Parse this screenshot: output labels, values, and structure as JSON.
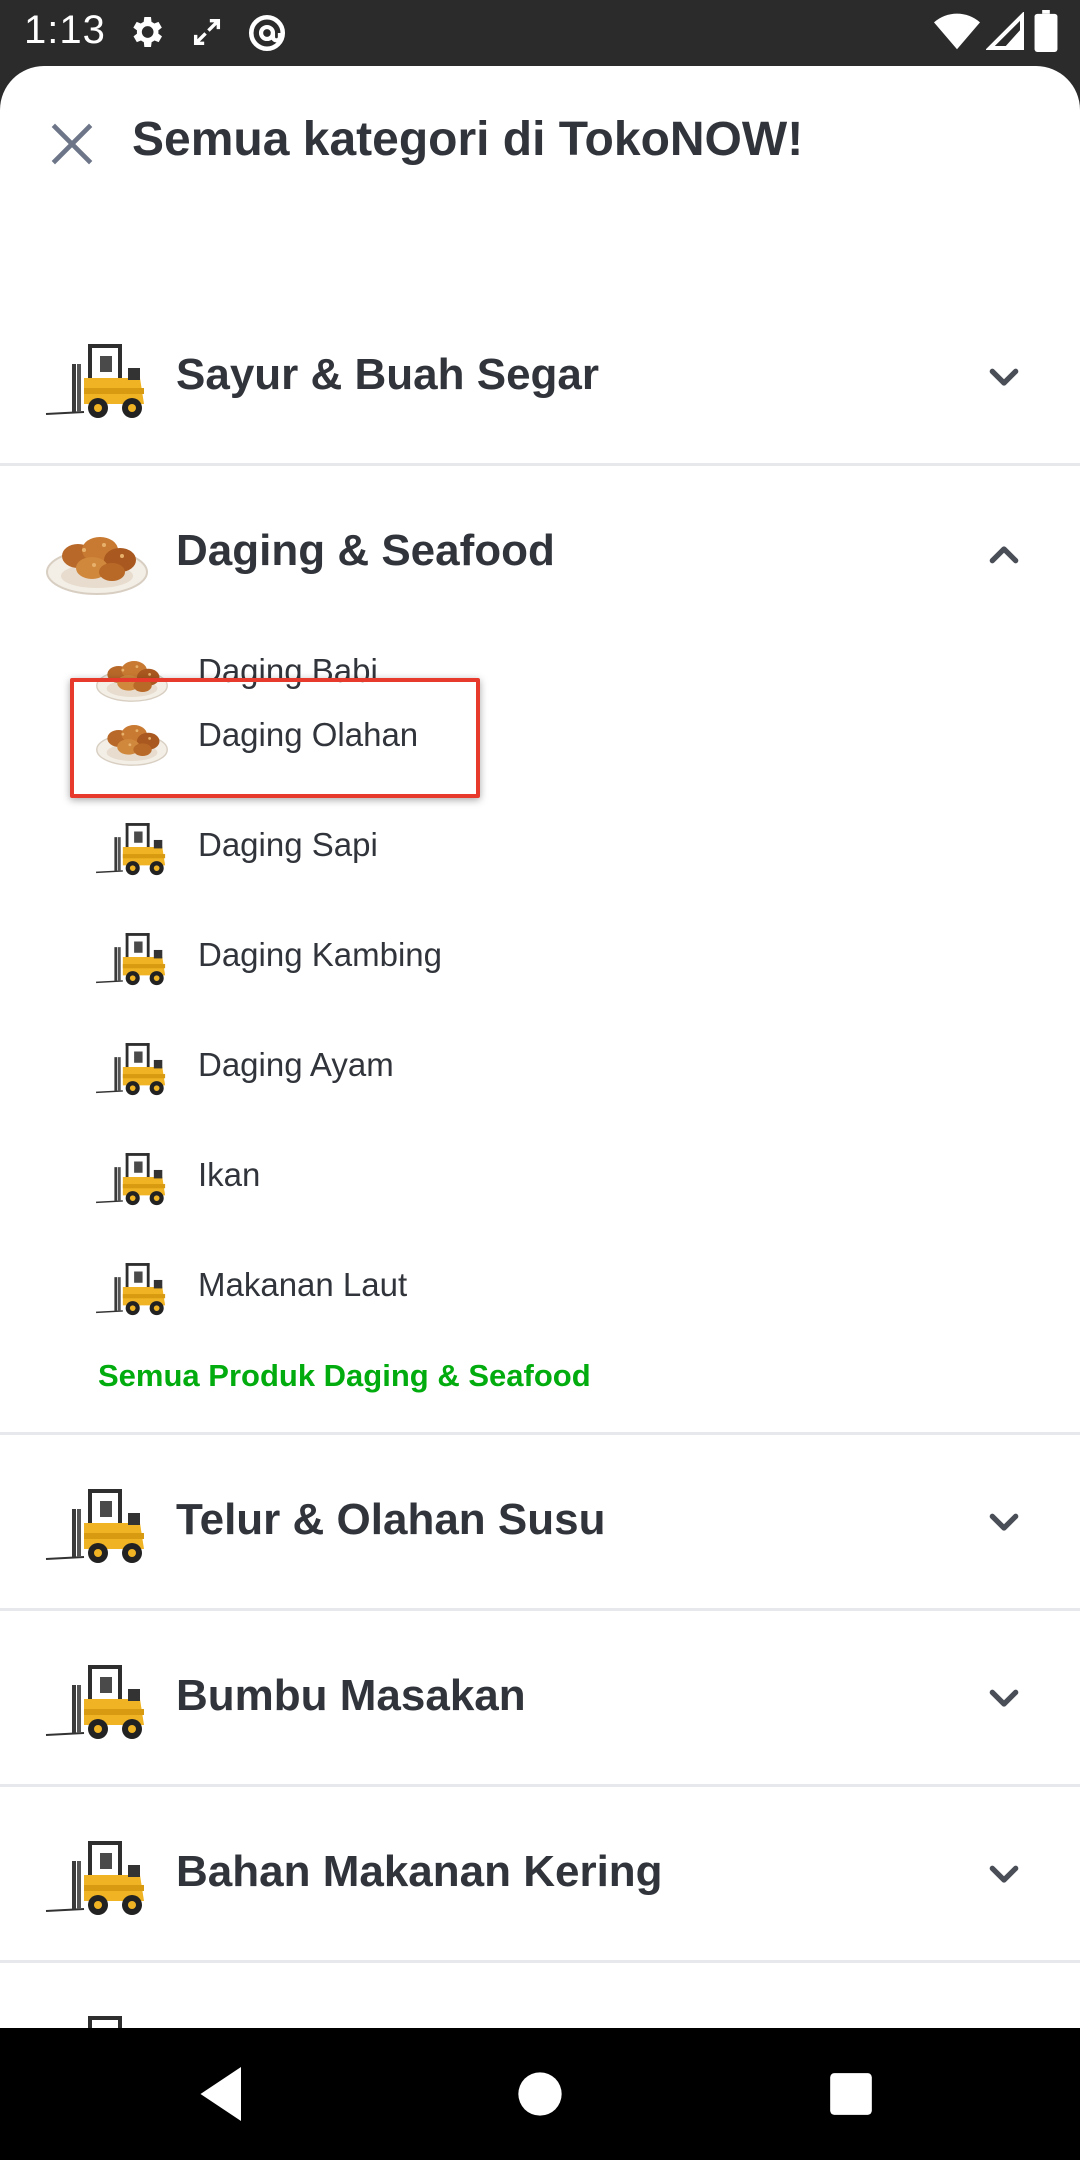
{
  "status_bar": {
    "time": "1:13",
    "icons": [
      "gear-icon",
      "expand-icon",
      "at-sign-icon",
      "wifi-icon",
      "signal-icon",
      "battery-icon"
    ]
  },
  "sheet": {
    "title": "Semua kategori di TokoNOW!",
    "close_icon": "close-icon"
  },
  "categories": [
    {
      "label": "Sayur & Buah Segar",
      "thumb": "forklift",
      "expanded": false
    },
    {
      "label": "Daging & Seafood",
      "thumb": "food",
      "expanded": true,
      "sub_items": [
        {
          "label": "Daging Babi",
          "thumb": "food"
        },
        {
          "label": "Daging Olahan",
          "thumb": "food",
          "highlighted": true
        },
        {
          "label": "Daging Sapi",
          "thumb": "forklift"
        },
        {
          "label": "Daging Kambing",
          "thumb": "forklift"
        },
        {
          "label": "Daging Ayam",
          "thumb": "forklift"
        },
        {
          "label": "Ikan",
          "thumb": "forklift"
        },
        {
          "label": "Makanan Laut",
          "thumb": "forklift"
        }
      ],
      "see_all": "Semua Produk Daging & Seafood"
    },
    {
      "label": "Telur & Olahan Susu",
      "thumb": "forklift",
      "expanded": false
    },
    {
      "label": "Bumbu Masakan",
      "thumb": "forklift",
      "expanded": false
    },
    {
      "label": "Bahan Makanan Kering",
      "thumb": "forklift",
      "expanded": false
    }
  ],
  "colors": {
    "accent_green": "#03ac0e",
    "highlight_red": "#e83a2c",
    "text_dark": "#31353b"
  },
  "nav_bar": {
    "icons": [
      "back-icon",
      "home-icon",
      "recents-icon"
    ]
  }
}
